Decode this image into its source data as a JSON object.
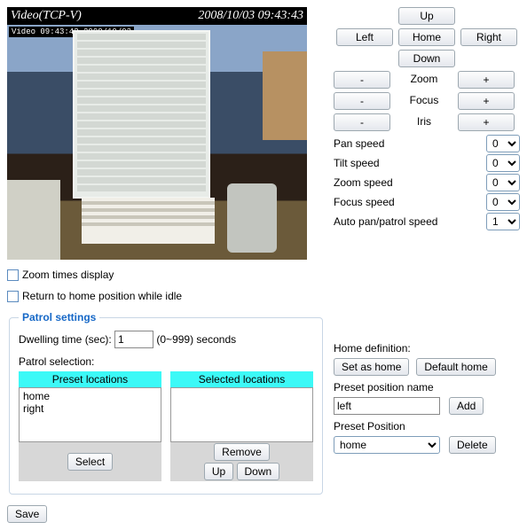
{
  "video": {
    "title": "Video(TCP-V)",
    "timestamp": "2008/10/03 09:43:43",
    "overlay": "Video 09:43:43 2008/10/03"
  },
  "checkboxes": {
    "zoom_times_display": "Zoom times display",
    "return_home_idle": "Return to home position while idle"
  },
  "patrol": {
    "legend": "Patrol settings",
    "dwelling_label": "Dwelling time (sec):",
    "dwelling_value": "1",
    "dwelling_suffix": "(0~999) seconds",
    "selection_label": "Patrol selection:",
    "preset_header": "Preset locations",
    "selected_header": "Selected locations",
    "preset_items": [
      "home",
      "right"
    ],
    "select_btn": "Select",
    "remove_btn": "Remove",
    "up_btn": "Up",
    "down_btn": "Down"
  },
  "ptz": {
    "up": "Up",
    "left": "Left",
    "home": "Home",
    "right": "Right",
    "down": "Down",
    "zoom": "Zoom",
    "focus": "Focus",
    "iris": "Iris",
    "minus": "-",
    "plus": "+",
    "pan_speed": "Pan speed",
    "pan_speed_val": "0",
    "tilt_speed": "Tilt speed",
    "tilt_speed_val": "0",
    "zoom_speed": "Zoom speed",
    "zoom_speed_val": "0",
    "focus_speed": "Focus speed",
    "focus_speed_val": "0",
    "auto_speed": "Auto pan/patrol speed",
    "auto_speed_val": "1"
  },
  "homedef": {
    "title": "Home definition:",
    "set_as_home": "Set as home",
    "default_home": "Default home",
    "preset_name_label": "Preset position name",
    "preset_name_value": "left",
    "add": "Add",
    "preset_pos_label": "Preset Position",
    "preset_pos_value": "home",
    "delete": "Delete"
  },
  "save": "Save"
}
